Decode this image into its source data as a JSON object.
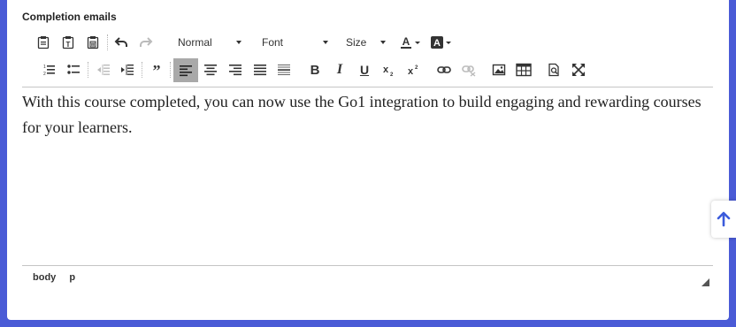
{
  "section": {
    "label": "Completion emails"
  },
  "toolbar": {
    "format_label": "Normal",
    "font_label": "Font",
    "size_label": "Size",
    "buttons_row1": [
      "paste-icon",
      "paste-text-icon",
      "paste-word-icon",
      "undo-icon",
      "redo-icon",
      "text-color-icon",
      "background-color-icon"
    ],
    "buttons_row2": [
      "numbered-list-icon",
      "bulleted-list-icon",
      "decrease-indent-icon",
      "increase-indent-icon",
      "blockquote-icon",
      "align-left-icon",
      "align-center-icon",
      "align-right-icon",
      "justify-icon",
      "horizontal-line-icon",
      "bold-icon",
      "italic-icon",
      "underline-icon",
      "subscript-icon",
      "superscript-icon",
      "link-icon",
      "unlink-icon",
      "image-icon",
      "table-icon",
      "preview-icon",
      "maximize-icon"
    ],
    "active_button": "align-left-icon"
  },
  "editor": {
    "content": "With this course completed, you can now use the Go1 integration to build engaging and rewarding courses for your learners."
  },
  "statusbar": {
    "path": [
      "body",
      "p"
    ]
  },
  "colors": {
    "page_background": "#4a5bd6",
    "active_button": "#a9a9a9",
    "scroll_arrow": "#3b5bdb"
  },
  "scroll_button": {
    "icon": "arrow-up-icon"
  }
}
